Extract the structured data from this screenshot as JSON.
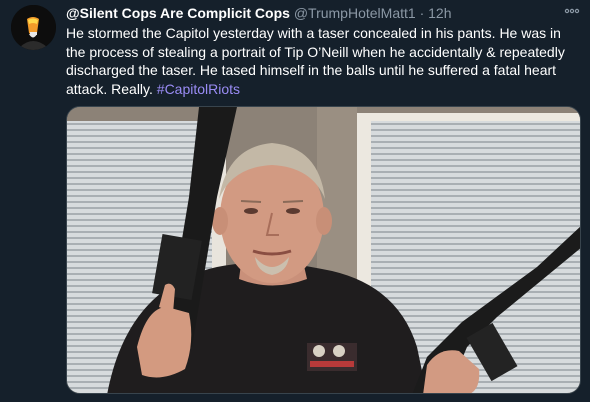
{
  "tweet": {
    "display_name": "@Silent Cops Are Complicit Cops",
    "handle": "@TrumpHotelMatt1",
    "separator": "·",
    "time": "12h",
    "more_icon": "ellipsis-icon",
    "text": "He stormed the Capitol yesterday with a taser concealed in his pants. He was in the process of stealing a portrait of Tip O’Neill  when he accidentally & repeatedly discharged the taser. He tased himself in the balls until he suffered a fatal  heart attack. Really. ",
    "hashtag": "#CapitolRiots",
    "hashtag_color": "#9a8cf5",
    "background_color": "#15202b",
    "muted_text_color": "#8b98a5"
  }
}
